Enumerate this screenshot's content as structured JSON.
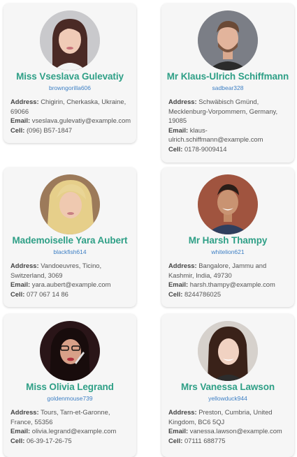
{
  "labels": {
    "address": "Address:",
    "email": "Email:",
    "cell": "Cell:"
  },
  "colors": {
    "name": "#2e9f86",
    "username": "#3d7fc4",
    "card_bg": "#f6f6f6"
  },
  "users": [
    {
      "name": "Miss Vseslava Gulevatiy",
      "username": "browngorilla606",
      "address": "Chigirin, Cherkaska, Ukraine, 69066",
      "email": "vseslava.gulevatiy@example.com",
      "cell": "(096) B57-1847",
      "photo": "woman-dark-hair"
    },
    {
      "name": "Mr Klaus-Ulrich Schiffmann",
      "username": "sadbear328",
      "address": "Schwäbisch Gmünd, Mecklenburg-Vorpommern, Germany, 19085",
      "email": "klaus-ulrich.schiffmann@example.com",
      "cell": "0178-9009414",
      "photo": "man-beard"
    },
    {
      "name": "Mademoiselle Yara Aubert",
      "username": "blackfish614",
      "address": "Vandoeuvres, Ticino, Switzerland, 3069",
      "email": "yara.aubert@example.com",
      "cell": "077 067 14 86",
      "photo": "woman-blonde"
    },
    {
      "name": "Mr Harsh Thampy",
      "username": "whitelion621",
      "address": "Bangalore, Jammu and Kashmir, India, 49730",
      "email": "harsh.thampy@example.com",
      "cell": "8244786025",
      "photo": "man-smiling"
    },
    {
      "name": "Miss Olivia Legrand",
      "username": "goldenmouse739",
      "address": "Tours, Tarn-et-Garonne, France, 55356",
      "email": "olivia.legrand@example.com",
      "cell": "06-39-17-26-75",
      "photo": "woman-glasses"
    },
    {
      "name": "Mrs Vanessa Lawson",
      "username": "yellowduck944",
      "address": "Preston, Cumbria, United Kingdom, BC6 5QJ",
      "email": "vanessa.lawson@example.com",
      "cell": "07111 688775",
      "photo": "woman-brunette"
    }
  ]
}
